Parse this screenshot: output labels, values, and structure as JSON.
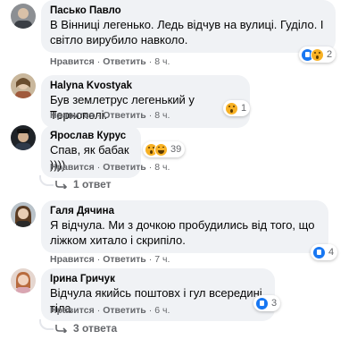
{
  "actions": {
    "like": "Нравится",
    "reply": "Ответить"
  },
  "comments": [
    {
      "author": "Пасько Павло",
      "lines": [
        "В Вінниці легенько. Ледь відчув на вулиці. Гуділо. І",
        "світло вирубило навколо."
      ],
      "time": "8 ч.",
      "reactions": {
        "icons": [
          "like",
          "wow"
        ],
        "count": "2"
      },
      "replies": ""
    },
    {
      "author": "Halyna Kvostyak",
      "lines": [
        "Був землетрус легенький у Тернополі."
      ],
      "time": "8 ч.",
      "reactions": {
        "icons": [
          "wow"
        ],
        "count": "1"
      },
      "replies": ""
    },
    {
      "author": "Ярослав Курус",
      "lines": [
        "Спав, як бабак ))))"
      ],
      "time": "8 ч.",
      "reactions": {
        "icons": [
          "wow",
          "haha"
        ],
        "count": "39"
      },
      "replies": "1 ответ"
    },
    {
      "author": "Галя Дячина",
      "lines": [
        "Я відчула. Ми з дочкою пробудились від того, що",
        "ліжком хитало і скрипіло."
      ],
      "time": "7 ч.",
      "reactions": {
        "icons": [
          "like"
        ],
        "count": "4"
      },
      "replies": ""
    },
    {
      "author": "Ірина Гричук",
      "lines": [
        "Відчула якийсь поштовх і гул всередині тіла"
      ],
      "time": "6 ч.",
      "reactions": {
        "icons": [
          "like"
        ],
        "count": "3"
      },
      "replies": "3 ответа"
    }
  ],
  "colors": {
    "bubble": "#f0f2f5",
    "meta": "#65676b",
    "like": "#1877f2",
    "wow": "#f7b125"
  }
}
